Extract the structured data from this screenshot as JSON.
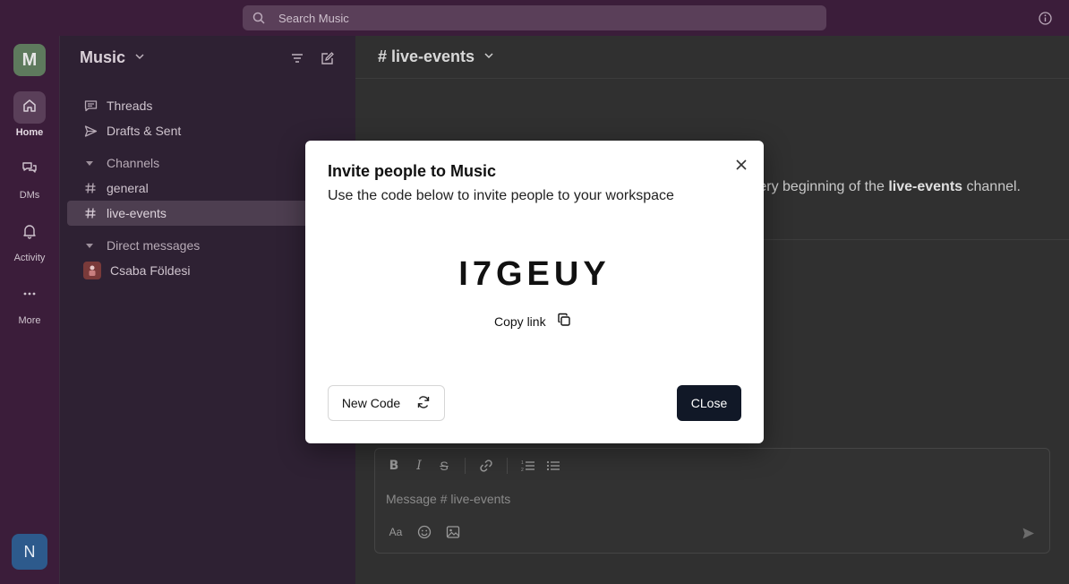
{
  "topbar": {
    "search_placeholder": "Search Music"
  },
  "rail": {
    "workspace_initial": "M",
    "items": [
      {
        "label": "Home",
        "icon": "home-icon"
      },
      {
        "label": "DMs",
        "icon": "dms-icon"
      },
      {
        "label": "Activity",
        "icon": "bell-icon"
      },
      {
        "label": "More",
        "icon": "more-icon"
      }
    ],
    "user_initial": "N"
  },
  "sidebar": {
    "workspace_name": "Music",
    "nav": [
      {
        "label": "Threads",
        "icon": "threads-icon"
      },
      {
        "label": "Drafts & Sent",
        "icon": "send-icon"
      }
    ],
    "channels_label": "Channels",
    "channels": [
      {
        "label": "general",
        "active": false
      },
      {
        "label": "live-events",
        "active": true
      }
    ],
    "dm_label": "Direct messages",
    "dms": [
      {
        "label": "Csaba Földesi"
      }
    ]
  },
  "main": {
    "channel_title": "# live-events",
    "intro_prefix": "ery beginning of the ",
    "intro_channel": "live-events",
    "intro_suffix": " channel.",
    "composer_placeholder": "Message # live-events",
    "format_text_label": "Aa"
  },
  "modal": {
    "title": "Invite people to Music",
    "subtitle": "Use the code below to invite people to your workspace",
    "code": "I7GEUY",
    "copy_link_label": "Copy link",
    "new_code_label": "New Code",
    "close_label": "CLose"
  },
  "colors": {
    "modal_primary_button": "#111827",
    "active_channel_bg": "#4d3e50",
    "user_avatar": "#2d5a8c"
  }
}
